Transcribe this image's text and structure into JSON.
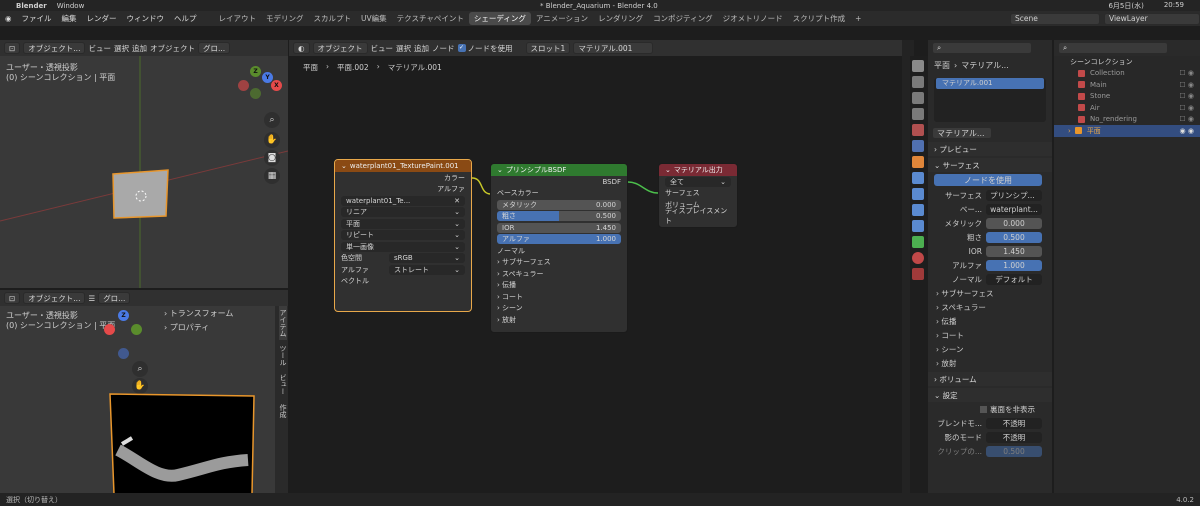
{
  "mac": {
    "apple": "",
    "app": "Blender",
    "window": "Window",
    "title": "* Blender_Aquarium - Blender 4.0",
    "date": "6月5日(水)",
    "time": "20:59"
  },
  "menus": [
    "ファイル",
    "編集",
    "レンダー",
    "ウィンドウ",
    "ヘルプ"
  ],
  "workspaces": [
    "レイアウト",
    "モデリング",
    "スカルプト",
    "UV編集",
    "テクスチャペイント",
    "シェーディング",
    "アニメーション",
    "レンダリング",
    "コンポジティング",
    "ジオメトリノード",
    "スクリプト作成"
  ],
  "active_workspace": "シェーディング",
  "scene": "Scene",
  "viewlayer": "ViewLayer",
  "vp1": {
    "mode": "オブジェクト...",
    "menus": [
      "ビュー",
      "選択",
      "追加",
      "オブジェクト"
    ],
    "orient": "グロ...",
    "info1": "ユーザー・透視投影",
    "info2": "(0) シーンコレクション | 平面"
  },
  "vp2": {
    "mode": "オブジェクト...",
    "orient": "グロ...",
    "info1": "ユーザー・透視投影",
    "info2": "(0) シーンコレクション | 平面",
    "side": [
      "トランスフォーム",
      "プロパティ"
    ],
    "tabs": [
      "アイテム",
      "ツール",
      "ビュー",
      "作成"
    ]
  },
  "ne": {
    "mode": "オブジェクト",
    "menus": [
      "ビュー",
      "選択",
      "追加",
      "ノード"
    ],
    "use_nodes": "ノードを使用",
    "slot": "スロット1",
    "material": "マテリアル.001",
    "crumbs": [
      "平面",
      "平面.002",
      "マテリアル.001"
    ]
  },
  "tex": {
    "title": "waterplant01_TexturePaint.001",
    "out": [
      "カラー",
      "アルファ"
    ],
    "img": "waterplant01_Te...",
    "interp": "リニア",
    "proj": "平面",
    "ext": "リピート",
    "src": "単一画像",
    "cs_label": "色空間",
    "cs": "sRGB",
    "alpha_label": "アルファ",
    "alpha": "ストレート",
    "vec": "ベクトル"
  },
  "bsdf": {
    "title": "プリンシプルBSDF",
    "out": "BSDF",
    "base": "ベースカラー",
    "rows": [
      {
        "l": "メタリック",
        "v": "0.000",
        "p": "0%"
      },
      {
        "l": "粗さ",
        "v": "0.500",
        "p": "50%"
      },
      {
        "l": "IOR",
        "v": "1.450",
        "p": "0%"
      },
      {
        "l": "アルファ",
        "v": "1.000",
        "p": "100%"
      }
    ],
    "normal": "ノーマル",
    "subs": [
      "サブサーフェス",
      "スペキュラー",
      "伝播",
      "コート",
      "シーン",
      "放射"
    ]
  },
  "mout": {
    "title": "マテリアル出力",
    "target": "全て",
    "sockets": [
      "サーフェス",
      "ボリューム",
      "ディスプレイスメント"
    ]
  },
  "props": {
    "obj": "平面",
    "mat": "マテリアル...",
    "slot": "マテリアル.001",
    "mat2": "マテリアル...",
    "preview": "プレビュー",
    "surface": "サーフェス",
    "use_nodes": "ノードを使用",
    "surf_label": "サーフェス",
    "surf_val": "プリンシプ...",
    "base_l": "ベー...",
    "base_v": "waterplant...",
    "rows": [
      {
        "l": "メタリック",
        "v": "0.000",
        "b": false
      },
      {
        "l": "粗さ",
        "v": "0.500",
        "b": true
      },
      {
        "l": "IOR",
        "v": "1.450",
        "b": false
      },
      {
        "l": "アルファ",
        "v": "1.000",
        "b": true
      }
    ],
    "normal_l": "ノーマル",
    "normal_v": "デフォルト",
    "subs": [
      "サブサーフェス",
      "スペキュラー",
      "伝播",
      "コート",
      "シーン",
      "放射"
    ],
    "volume": "ボリューム",
    "settings": "設定",
    "backface": "裏面を非表示",
    "blend_l": "ブレンドモ...",
    "blend_v": "不透明",
    "shadow_l": "影のモード",
    "shadow_v": "不透明",
    "clip_l": "クリップの...",
    "clip_v": "0.500"
  },
  "outliner": {
    "root": "シーンコレクション",
    "items": [
      "Collection",
      "Main",
      "Stone",
      "Air",
      "No_rendering",
      "平面"
    ]
  },
  "status": {
    "left": "選択（切り替え）",
    "version": "4.0.2"
  }
}
